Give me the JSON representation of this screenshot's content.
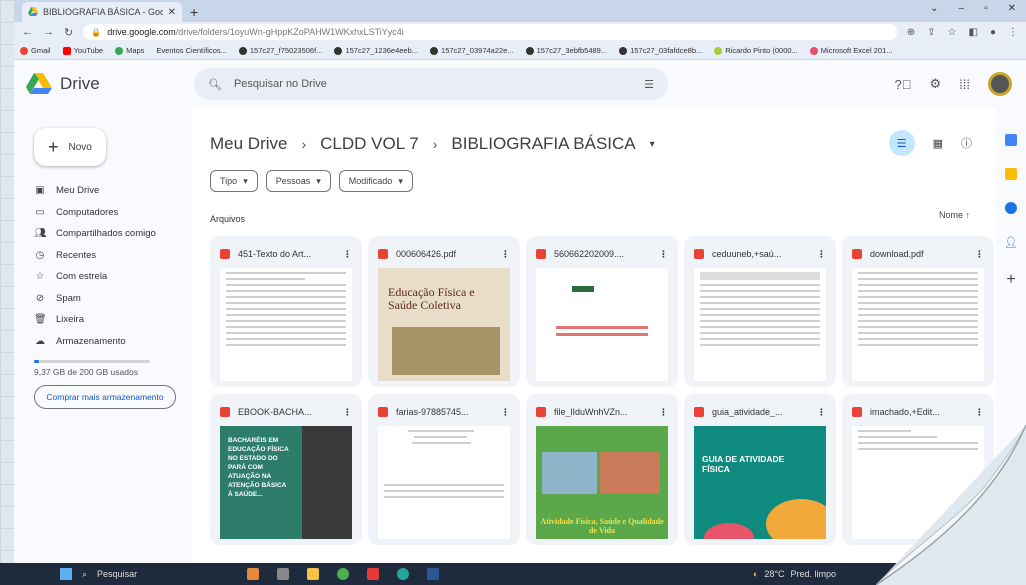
{
  "browser": {
    "tab_title": "BIBLIOGRAFIA BÁSICA - Google",
    "url_host": "drive.google.com",
    "url_path": "/drive/folders/1oyuWn-gHppKZoPAHW1WKxhxLSTiYyc4i",
    "bookmarks": [
      "Gmail",
      "YouTube",
      "Maps",
      "Eventos Científicos...",
      "157c27_f75023506f...",
      "157c27_1236e4eeb...",
      "157c27_03974a22e...",
      "157c27_3ebfb5489...",
      "157c27_03fafdce8b...",
      "Ricardo Pinto (0000...",
      "Microsoft Excel 201..."
    ]
  },
  "drive": {
    "logo_text": "Drive",
    "search_placeholder": "Pesquisar no Drive",
    "new_label": "Novo",
    "nav": [
      {
        "label": "Meu Drive",
        "icon": "drive-icon"
      },
      {
        "label": "Computadores",
        "icon": "computer-icon"
      },
      {
        "label": "Compartilhados comigo",
        "icon": "shared-icon"
      },
      {
        "label": "Recentes",
        "icon": "clock-icon"
      },
      {
        "label": "Com estrela",
        "icon": "star-icon"
      },
      {
        "label": "Spam",
        "icon": "spam-icon"
      },
      {
        "label": "Lixeira",
        "icon": "trash-icon"
      },
      {
        "label": "Armazenamento",
        "icon": "cloud-icon"
      }
    ],
    "storage_text": "9,37 GB de 200 GB usados",
    "storage_used_fraction": 0.047,
    "buy_storage": "Comprar mais armazenamento",
    "breadcrumb": [
      "Meu Drive",
      "CLDD VOL 7",
      "BIBLIOGRAFIA BÁSICA"
    ],
    "filters": [
      "Tipo",
      "Pessoas",
      "Modificado"
    ],
    "section_label": "Arquivos",
    "sort_label": "Nome",
    "files": [
      {
        "name": "451-Texto do Art...",
        "thumb_text": ""
      },
      {
        "name": "000606426.pdf",
        "thumb_text": "Educação Física e Saúde Coletiva"
      },
      {
        "name": "560662202009....",
        "thumb_text": ""
      },
      {
        "name": "ceduuneb,+saú...",
        "thumb_text": ""
      },
      {
        "name": "download.pdf",
        "thumb_text": ""
      },
      {
        "name": "EBOOK-BACHA...",
        "thumb_text": "BACHARÉIS EM EDUCAÇÃO FÍSICA NO ESTADO DO PARÁ COM ATUAÇÃO NA ATENÇÃO BÁSICA À SAÚDE..."
      },
      {
        "name": "farias-97885745...",
        "thumb_text": ""
      },
      {
        "name": "file_lIduWnhVZn...",
        "thumb_text": "Atividade Física, Saúde e Qualidade de Vida"
      },
      {
        "name": "guia_atividade_...",
        "thumb_text": "GUIA DE ATIVIDADE FÍSICA"
      },
      {
        "name": "imachado,+Edit...",
        "thumb_text": ""
      }
    ]
  },
  "taskbar": {
    "search_label": "Pesquisar",
    "weather": "28°C",
    "weather_desc": "Pred. limpo"
  },
  "colors": {
    "accent": "#1a73e8",
    "pdf": "#ea4335",
    "selected_filter": "#c2e7ff"
  }
}
